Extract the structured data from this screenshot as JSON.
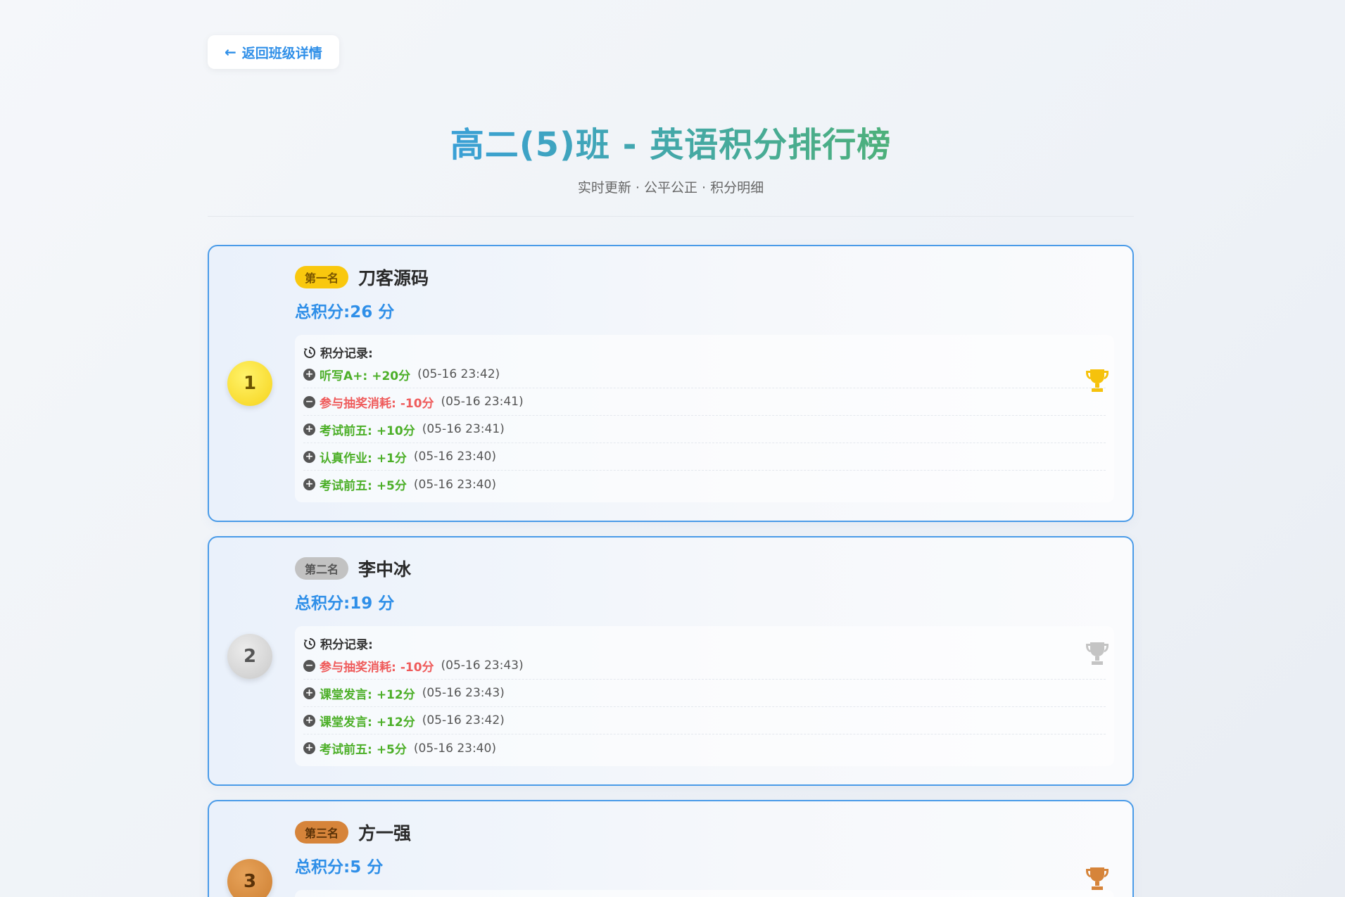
{
  "nav": {
    "back_label": "返回班级详情"
  },
  "header": {
    "title": "高二(5)班 - 英语积分排行榜",
    "subtitle": "实时更新 · 公平公正 · 积分明细"
  },
  "records_label": "积分记录:",
  "cards": [
    {
      "rank": "1",
      "badge": "第一名",
      "name": "刀客源码",
      "total": "总积分:26 分",
      "trophy_color": "#f6c20c",
      "records": [
        {
          "type": "plus",
          "label": "听写A+:",
          "points": "+20分",
          "time": "(05-16 23:42)"
        },
        {
          "type": "minus",
          "label": "参与抽奖消耗:",
          "points": "-10分",
          "time": "(05-16 23:41)"
        },
        {
          "type": "plus",
          "label": "考试前五:",
          "points": "+10分",
          "time": "(05-16 23:41)"
        },
        {
          "type": "plus",
          "label": "认真作业:",
          "points": "+1分",
          "time": "(05-16 23:40)"
        },
        {
          "type": "plus",
          "label": "考试前五:",
          "points": "+5分",
          "time": "(05-16 23:40)"
        }
      ]
    },
    {
      "rank": "2",
      "badge": "第二名",
      "name": "李中冰",
      "total": "总积分:19 分",
      "trophy_color": "#c4c4c4",
      "records": [
        {
          "type": "minus",
          "label": "参与抽奖消耗:",
          "points": "-10分",
          "time": "(05-16 23:43)"
        },
        {
          "type": "plus",
          "label": "课堂发言:",
          "points": "+12分",
          "time": "(05-16 23:43)"
        },
        {
          "type": "plus",
          "label": "课堂发言:",
          "points": "+12分",
          "time": "(05-16 23:42)"
        },
        {
          "type": "plus",
          "label": "考试前五:",
          "points": "+5分",
          "time": "(05-16 23:40)"
        }
      ]
    },
    {
      "rank": "3",
      "badge": "第三名",
      "name": "方一强",
      "total": "总积分:5 分",
      "trophy_color": "#d6843a",
      "records": []
    }
  ]
}
